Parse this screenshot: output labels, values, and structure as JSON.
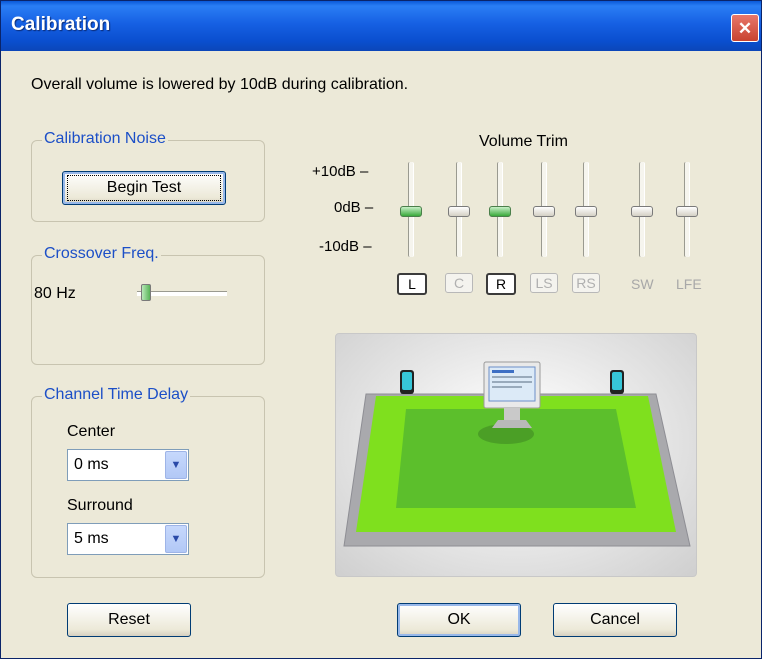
{
  "window": {
    "title": "Calibration"
  },
  "notice": "Overall volume is lowered by 10dB during calibration.",
  "calibration_noise": {
    "title": "Calibration Noise",
    "begin_test": "Begin Test"
  },
  "crossover": {
    "title": "Crossover Freq.",
    "value": "80 Hz",
    "level": 0.05
  },
  "delay": {
    "title": "Channel Time Delay",
    "center_label": "Center",
    "center_value": "0 ms",
    "surround_label": "Surround",
    "surround_value": "5 ms"
  },
  "volume_trim": {
    "title": "Volume Trim",
    "ticks": [
      "+10dB –",
      "0dB –",
      "-10dB –"
    ],
    "sliders": [
      {
        "level_db": 0,
        "active": true
      },
      {
        "level_db": 0,
        "active": false
      },
      {
        "level_db": 0,
        "active": true
      },
      {
        "level_db": 0,
        "active": false
      },
      {
        "level_db": 0,
        "active": false
      },
      {
        "level_db": 0,
        "active": false
      },
      {
        "level_db": 0,
        "active": false
      }
    ],
    "channels": [
      "L",
      "C",
      "R",
      "LS",
      "RS",
      "SW",
      "LFE"
    ]
  },
  "buttons": {
    "reset": "Reset",
    "ok": "OK",
    "cancel": "Cancel"
  },
  "colors": {
    "floor": "#7fe01e",
    "title_bar": "#0a4fcf",
    "group_title": "#1c4fc7"
  }
}
